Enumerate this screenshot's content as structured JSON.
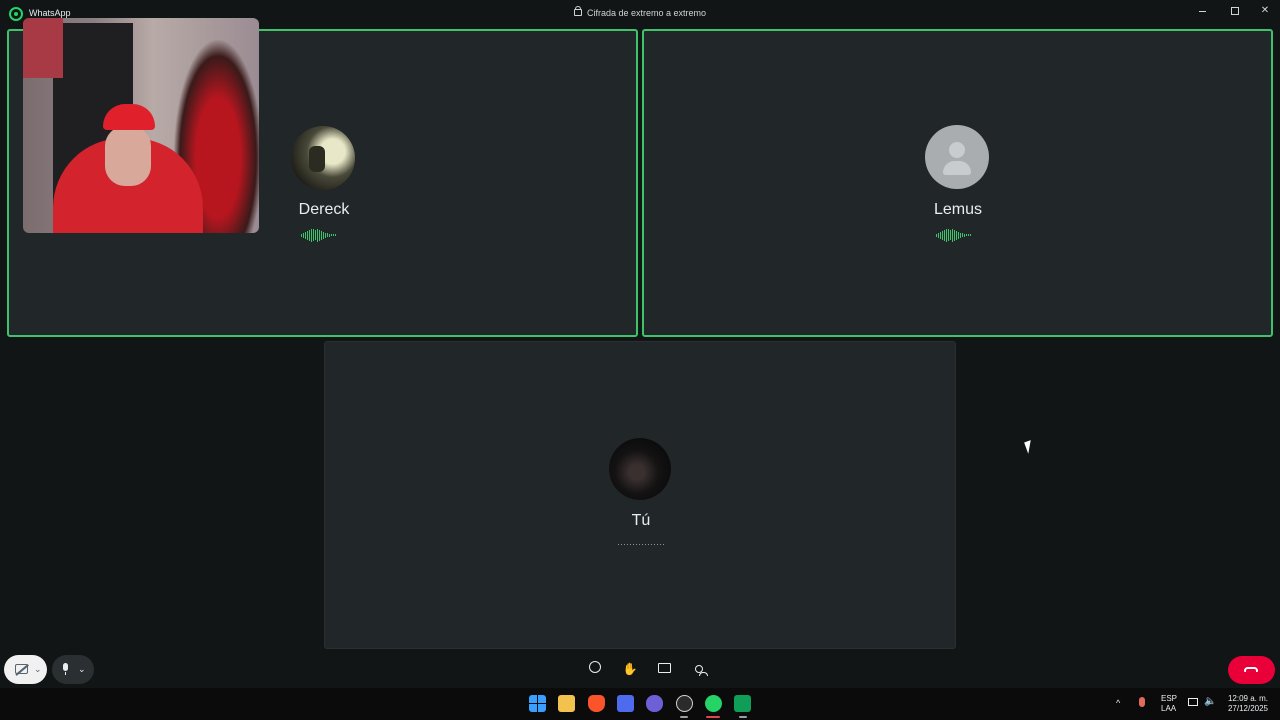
{
  "window": {
    "app_name": "WhatsApp",
    "encryption_notice": "Cifrada de extremo a extremo"
  },
  "participants": [
    {
      "name": "Dereck",
      "status": "speaking",
      "avatar": "photo-avatar"
    },
    {
      "name": "Lemus",
      "status": "speaking",
      "avatar": "default-person-icon"
    },
    {
      "name": "Tú",
      "status": "muted",
      "avatar": "photo-avatar"
    }
  ],
  "self_view": {
    "type": "camera-preview"
  },
  "controls": {
    "camera": {
      "icon": "camera-off-icon",
      "state": "off"
    },
    "microphone": {
      "icon": "microphone-icon",
      "state": "on"
    },
    "center": [
      {
        "icon": "emoji-icon"
      },
      {
        "icon": "raise-hand-icon"
      },
      {
        "icon": "screen-share-icon"
      },
      {
        "icon": "participants-icon"
      }
    ],
    "end_call": {
      "icon": "end-call-icon",
      "color": "#ea0038"
    }
  },
  "taskbar": {
    "apps": [
      "windows-start-icon",
      "file-explorer-icon",
      "brave-browser-icon",
      "microsoft-store-icon",
      "game-controller-icon",
      "obs-icon",
      "whatsapp-icon",
      "google-sheets-icon"
    ],
    "language": "ESP",
    "layout": "LAA",
    "time": "12:09 a. m.",
    "date": "27/12/2025"
  },
  "colors": {
    "speaking_border": "#3fc26a",
    "tile_background": "#212628",
    "app_background": "#111516"
  }
}
